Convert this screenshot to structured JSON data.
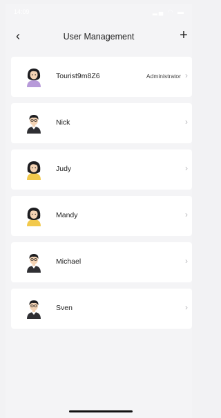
{
  "status_bar": {
    "time": "14:09",
    "icons": "▂▄ ◠ ▬"
  },
  "header": {
    "title": "User Management",
    "back_icon": "‹",
    "add_icon": "+"
  },
  "users": [
    {
      "name": "Tourist9m8Z6",
      "role": "Administrator",
      "avatar": "female-purple"
    },
    {
      "name": "Nick",
      "role": "",
      "avatar": "male"
    },
    {
      "name": "Judy",
      "role": "",
      "avatar": "female-yellow"
    },
    {
      "name": "Mandy",
      "role": "",
      "avatar": "female-yellow"
    },
    {
      "name": "Michael",
      "role": "",
      "avatar": "male"
    },
    {
      "name": "Sven",
      "role": "",
      "avatar": "male"
    }
  ],
  "chevron": "›"
}
